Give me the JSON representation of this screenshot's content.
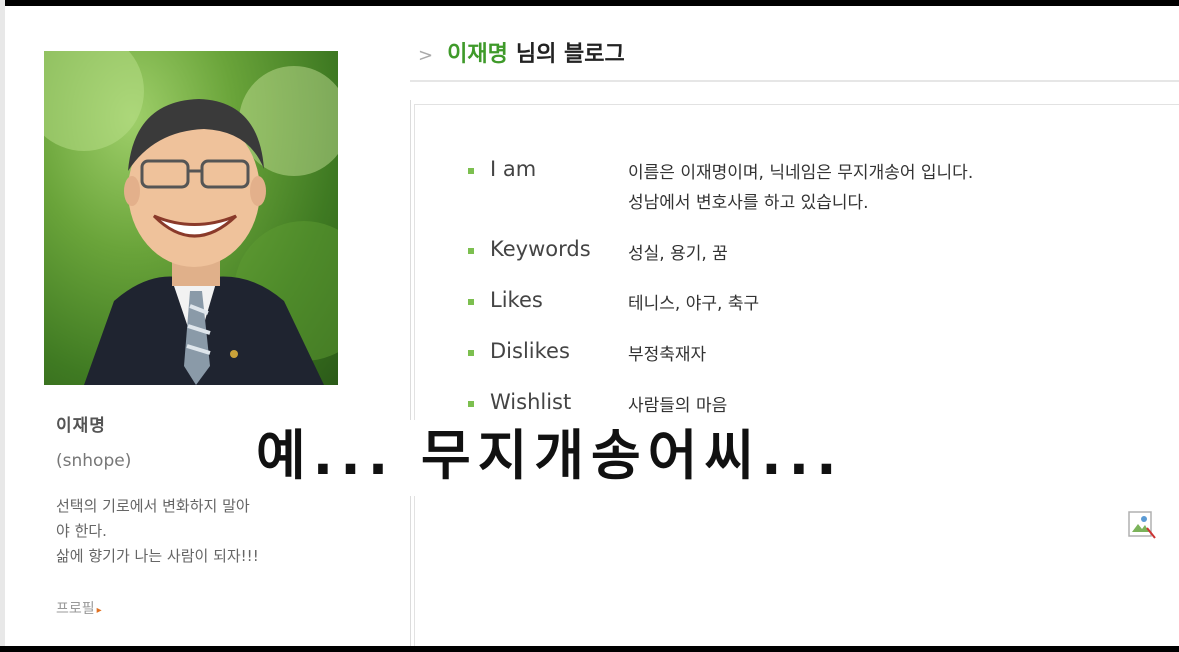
{
  "header": {
    "owner_name": "이재명",
    "title_suffix": "님의 블로그"
  },
  "profile": {
    "name": "이재명",
    "id": "(snhope)",
    "motto": [
      "선택의 기로에서 변화하지 말아",
      "야 한다.",
      "삶에 향기가 나는 사람이 되자!!!"
    ],
    "link_label": "프로필"
  },
  "info": [
    {
      "label": "I am",
      "value": [
        "이름은 이재명이며, 닉네임은 무지개송어 입니다.",
        "성남에서 변호사를 하고 있습니다."
      ]
    },
    {
      "label": "Keywords",
      "value": [
        "성실, 용기, 꿈"
      ]
    },
    {
      "label": "Likes",
      "value": [
        "테니스, 야구, 축구"
      ]
    },
    {
      "label": "Dislikes",
      "value": [
        "부정축재자"
      ]
    },
    {
      "label": "Wishlist",
      "value": [
        "사람들의 마음"
      ]
    }
  ],
  "caption": "예... 무지개송어씨...",
  "colors": {
    "accent": "#3f9a2a",
    "bullet": "#7cbf4f"
  }
}
